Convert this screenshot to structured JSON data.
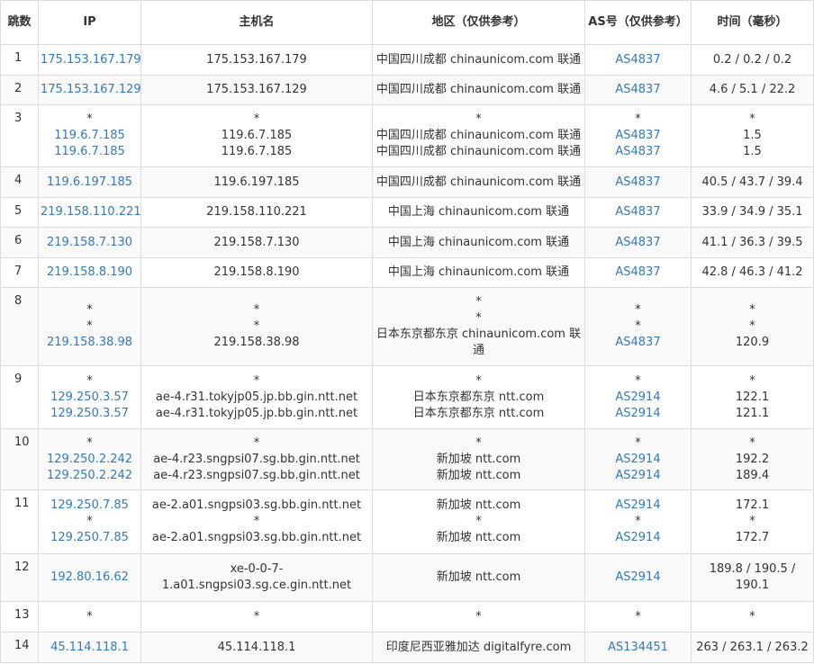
{
  "headers": {
    "hop": "跳数",
    "ip": "IP",
    "host": "主机名",
    "region": "地区（仅供参考）",
    "asn": "AS号（仅供参考）",
    "time": "时间（毫秒）"
  },
  "rows": [
    {
      "hop": "1",
      "ip": [
        "175.153.167.179"
      ],
      "host": [
        "175.153.167.179"
      ],
      "region": [
        "中国四川成都 chinaunicom.com 联通"
      ],
      "asn": [
        "AS4837"
      ],
      "time": [
        "0.2 / 0.2 / 0.2"
      ]
    },
    {
      "hop": "2",
      "ip": [
        "175.153.167.129"
      ],
      "host": [
        "175.153.167.129"
      ],
      "region": [
        "中国四川成都 chinaunicom.com 联通"
      ],
      "asn": [
        "AS4837"
      ],
      "time": [
        "4.6 / 5.1 / 22.2"
      ]
    },
    {
      "hop": "3",
      "ip": [
        "*",
        "119.6.7.185",
        "119.6.7.185"
      ],
      "host": [
        "*",
        "119.6.7.185",
        "119.6.7.185"
      ],
      "region": [
        "*",
        "中国四川成都 chinaunicom.com 联通",
        "中国四川成都 chinaunicom.com 联通"
      ],
      "asn": [
        "*",
        "AS4837",
        "AS4837"
      ],
      "time": [
        "*",
        "1.5",
        "1.5"
      ]
    },
    {
      "hop": "4",
      "ip": [
        "119.6.197.185"
      ],
      "host": [
        "119.6.197.185"
      ],
      "region": [
        "中国四川成都 chinaunicom.com 联通"
      ],
      "asn": [
        "AS4837"
      ],
      "time": [
        "40.5 / 43.7 / 39.4"
      ]
    },
    {
      "hop": "5",
      "ip": [
        "219.158.110.221"
      ],
      "host": [
        "219.158.110.221"
      ],
      "region": [
        "中国上海 chinaunicom.com 联通"
      ],
      "asn": [
        "AS4837"
      ],
      "time": [
        "33.9 / 34.9 / 35.1"
      ]
    },
    {
      "hop": "6",
      "ip": [
        "219.158.7.130"
      ],
      "host": [
        "219.158.7.130"
      ],
      "region": [
        "中国上海 chinaunicom.com 联通"
      ],
      "asn": [
        "AS4837"
      ],
      "time": [
        "41.1 / 36.3 / 39.5"
      ]
    },
    {
      "hop": "7",
      "ip": [
        "219.158.8.190"
      ],
      "host": [
        "219.158.8.190"
      ],
      "region": [
        "中国上海 chinaunicom.com 联通"
      ],
      "asn": [
        "AS4837"
      ],
      "time": [
        "42.8 / 46.3 / 41.2"
      ]
    },
    {
      "hop": "8",
      "ip": [
        "*",
        "*",
        "219.158.38.98"
      ],
      "host": [
        "*",
        "*",
        "219.158.38.98"
      ],
      "region": [
        "*",
        "*",
        "日本东京都东京 chinaunicom.com 联",
        "通"
      ],
      "asn": [
        "*",
        "*",
        "AS4837"
      ],
      "time": [
        "*",
        "*",
        "120.9"
      ]
    },
    {
      "hop": "9",
      "ip": [
        "*",
        "129.250.3.57",
        "129.250.3.57"
      ],
      "host": [
        "*",
        "ae-4.r31.tokyjp05.jp.bb.gin.ntt.net",
        "ae-4.r31.tokyjp05.jp.bb.gin.ntt.net"
      ],
      "region": [
        "*",
        "日本东京都东京 ntt.com",
        "日本东京都东京 ntt.com"
      ],
      "asn": [
        "*",
        "AS2914",
        "AS2914"
      ],
      "time": [
        "*",
        "122.1",
        "121.1"
      ]
    },
    {
      "hop": "10",
      "ip": [
        "*",
        "129.250.2.242",
        "129.250.2.242"
      ],
      "host": [
        "*",
        "ae-4.r23.sngpsi07.sg.bb.gin.ntt.net",
        "ae-4.r23.sngpsi07.sg.bb.gin.ntt.net"
      ],
      "region": [
        "*",
        "新加坡 ntt.com",
        "新加坡 ntt.com"
      ],
      "asn": [
        "*",
        "AS2914",
        "AS2914"
      ],
      "time": [
        "*",
        "192.2",
        "189.4"
      ]
    },
    {
      "hop": "11",
      "ip": [
        "129.250.7.85",
        "*",
        "129.250.7.85"
      ],
      "host": [
        "ae-2.a01.sngpsi03.sg.bb.gin.ntt.net",
        "*",
        "ae-2.a01.sngpsi03.sg.bb.gin.ntt.net"
      ],
      "region": [
        "新加坡 ntt.com",
        "*",
        "新加坡 ntt.com"
      ],
      "asn": [
        "AS2914",
        "*",
        "AS2914"
      ],
      "time": [
        "172.1",
        "*",
        "172.7"
      ]
    },
    {
      "hop": "12",
      "ip": [
        "192.80.16.62"
      ],
      "host": [
        "xe-0-0-7-",
        "1.a01.sngpsi03.sg.ce.gin.ntt.net"
      ],
      "region": [
        "新加坡 ntt.com"
      ],
      "asn": [
        "AS2914"
      ],
      "time": [
        "189.8 / 190.5 /",
        "190.1"
      ]
    },
    {
      "hop": "13",
      "ip": [
        "*"
      ],
      "host": [
        "*"
      ],
      "region": [
        "*"
      ],
      "asn": [
        "*"
      ],
      "time": [
        "*"
      ]
    },
    {
      "hop": "14",
      "ip": [
        "45.114.118.1"
      ],
      "host": [
        "45.114.118.1"
      ],
      "region": [
        "印度尼西亚雅加达 digitalfyre.com"
      ],
      "asn": [
        "AS134451"
      ],
      "time": [
        "263 / 263.1 / 263.2"
      ]
    }
  ]
}
